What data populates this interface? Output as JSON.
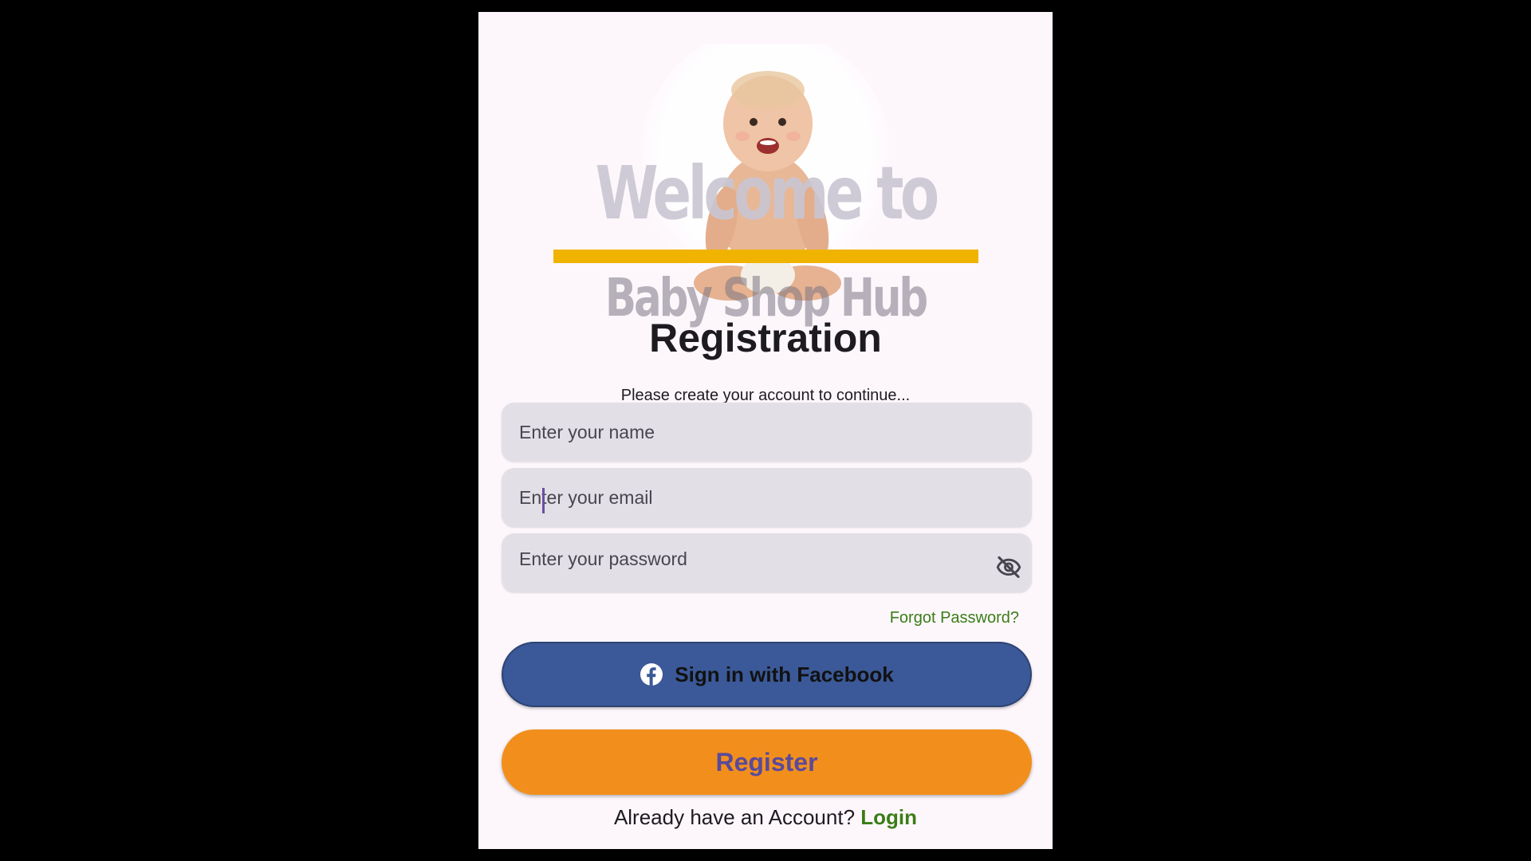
{
  "hero": {
    "welcome_text": "Welcome to",
    "brand_text": "Baby Shop Hub",
    "accent_color": "#f0b400"
  },
  "form": {
    "title": "Registration",
    "subtitle": "Please create your account to continue...",
    "name_placeholder": "Enter your name",
    "name_value": "",
    "email_placeholder": "Enter your email",
    "email_value": "",
    "password_placeholder": "Enter your password",
    "password_value": "",
    "password_toggle_icon": "visibility-off-icon",
    "forgot_password_label": "Forgot Password?"
  },
  "actions": {
    "facebook_label": "Sign in with Facebook",
    "facebook_icon": "facebook-icon",
    "facebook_color": "#3b5998",
    "register_label": "Register",
    "register_color": "#f28f1c"
  },
  "footer": {
    "prompt": "Already have an Account?",
    "login_label": "Login",
    "link_color": "#3b7d16"
  }
}
